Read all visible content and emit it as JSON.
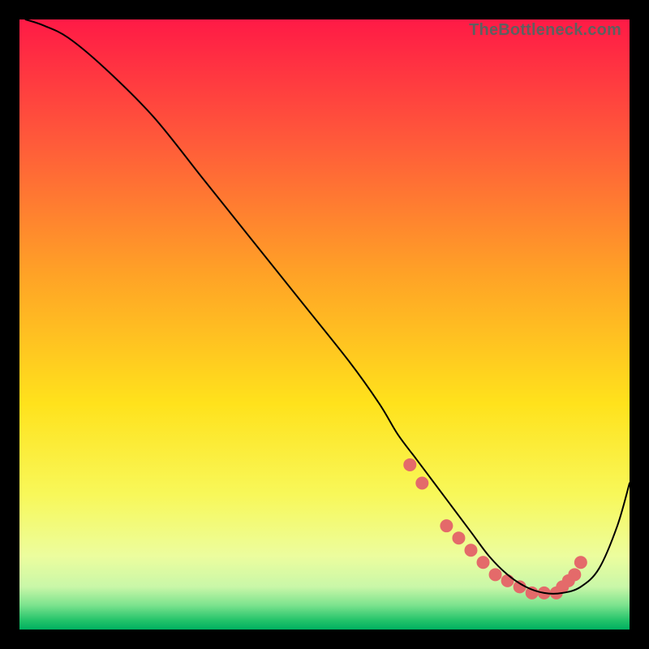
{
  "watermark": "TheBottleneck.com",
  "chart_data": {
    "type": "line",
    "title": "",
    "xlabel": "",
    "ylabel": "",
    "xlim": [
      0,
      100
    ],
    "ylim": [
      0,
      100
    ],
    "grid": false,
    "legend": false,
    "background_gradient_stops": [
      {
        "offset": 0.0,
        "color": "#ff1a46"
      },
      {
        "offset": 0.2,
        "color": "#ff5a3a"
      },
      {
        "offset": 0.42,
        "color": "#ffa326"
      },
      {
        "offset": 0.63,
        "color": "#ffe21c"
      },
      {
        "offset": 0.78,
        "color": "#f8f85a"
      },
      {
        "offset": 0.88,
        "color": "#ecfd9e"
      },
      {
        "offset": 0.93,
        "color": "#c9f7a8"
      },
      {
        "offset": 0.96,
        "color": "#7ce38e"
      },
      {
        "offset": 0.985,
        "color": "#23c36a"
      },
      {
        "offset": 1.0,
        "color": "#00b060"
      }
    ],
    "curve": {
      "x": [
        1,
        4,
        8,
        14,
        22,
        30,
        38,
        46,
        54,
        59,
        62,
        65,
        68,
        71,
        74,
        77,
        80,
        83,
        86,
        89,
        92,
        95,
        98,
        100
      ],
      "y": [
        100,
        99,
        97,
        92,
        84,
        74,
        64,
        54,
        44,
        37,
        32,
        28,
        24,
        20,
        16,
        12,
        9,
        7,
        6,
        6,
        7,
        10,
        17,
        24
      ]
    },
    "curve_style": {
      "stroke": "#000000",
      "width": 2
    },
    "markers": {
      "x": [
        64,
        66,
        70,
        72,
        74,
        76,
        78,
        80,
        82,
        84,
        86,
        88,
        89,
        90,
        91,
        92
      ],
      "y": [
        27,
        24,
        17,
        15,
        13,
        11,
        9,
        8,
        7,
        6,
        6,
        6,
        7,
        8,
        9,
        11
      ],
      "color": "#e46a6a",
      "radius": 8
    }
  }
}
